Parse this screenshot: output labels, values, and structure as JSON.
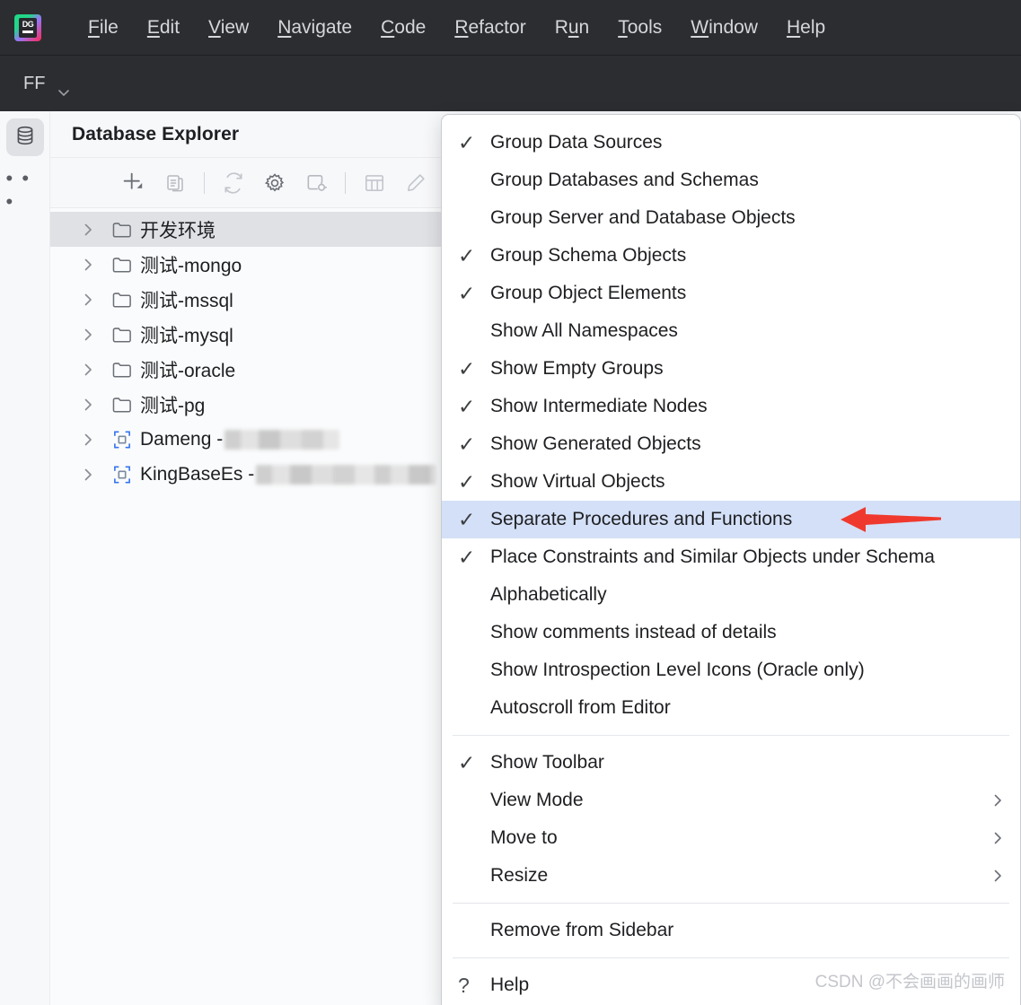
{
  "app": {
    "logo_text": "DG",
    "accent_red": "#f0392e",
    "highlight_blue": "#d4e0f7",
    "selection_gray": "#e0e1e5",
    "menubar_bg": "#2b2d30"
  },
  "menubar": {
    "items": [
      {
        "mnemonic": "F",
        "rest": "ile",
        "name": "file"
      },
      {
        "mnemonic": "E",
        "rest": "dit",
        "name": "edit"
      },
      {
        "mnemonic": "V",
        "rest": "iew",
        "name": "view"
      },
      {
        "mnemonic": "N",
        "rest": "avigate",
        "name": "navigate"
      },
      {
        "mnemonic": "C",
        "rest": "ode",
        "name": "code"
      },
      {
        "mnemonic": "R",
        "rest": "efactor",
        "name": "refactor"
      },
      {
        "mnemonic": "R",
        "rest": "un",
        "name": "run",
        "mn_index": 1,
        "pre": "R",
        "mid": "u",
        "post": "n"
      },
      {
        "mnemonic": "T",
        "rest": "ools",
        "name": "tools"
      },
      {
        "mnemonic": "W",
        "rest": "indow",
        "name": "window"
      },
      {
        "mnemonic": "H",
        "rest": "elp",
        "name": "help"
      }
    ]
  },
  "subbar": {
    "project_name": "FF",
    "chevron_icon": "chevron-down-icon"
  },
  "rail": {
    "active_tool": "database-explorer",
    "database_icon": "database-icon",
    "more_label": "• • •"
  },
  "tool_window": {
    "title": "Database Explorer",
    "header_actions": [
      {
        "name": "scroll-from-source-icon",
        "icon": "target-icon"
      },
      {
        "name": "expand-collapse-icon",
        "icon": "chevron-updown-icon"
      },
      {
        "name": "hide-icon",
        "icon": "collapse-x-icon"
      }
    ],
    "toolbar_buttons": [
      {
        "name": "add-new-button",
        "icon": "plus-dropdown-icon"
      },
      {
        "name": "duplicate-button",
        "icon": "copy-document-icon"
      },
      {
        "name": "refresh-button",
        "icon": "refresh-icon"
      },
      {
        "name": "data-source-properties-button",
        "icon": "gear-icon"
      },
      {
        "name": "disconnect-button",
        "icon": "database-plug-icon"
      },
      {
        "name": "open-table-button",
        "icon": "table-icon"
      },
      {
        "name": "modify-button",
        "icon": "pencil-icon"
      },
      {
        "name": "sync-button",
        "icon": "sync-arrows-icon"
      },
      {
        "name": "open-console-button",
        "icon": "console-icon"
      }
    ]
  },
  "tree": {
    "items": [
      {
        "label": "开发环境",
        "icon": "folder-icon",
        "selected": true,
        "blurred": false
      },
      {
        "label": "测试-mongo",
        "icon": "folder-icon",
        "selected": false,
        "blurred": false
      },
      {
        "label": "测试-mssql",
        "icon": "folder-icon",
        "selected": false,
        "blurred": false
      },
      {
        "label": "测试-mysql",
        "icon": "folder-icon",
        "selected": false,
        "blurred": false
      },
      {
        "label": "测试-oracle",
        "icon": "folder-icon",
        "selected": false,
        "blurred": false
      },
      {
        "label": "测试-pg",
        "icon": "folder-icon",
        "selected": false,
        "blurred": false
      },
      {
        "label": "Dameng -",
        "icon": "datasource-icon",
        "selected": false,
        "blurred": true,
        "blur_width": 128
      },
      {
        "label": "KingBaseEs -",
        "icon": "datasource-icon",
        "selected": false,
        "blurred": true,
        "blur_width": 200
      }
    ]
  },
  "context_menu": {
    "groups": [
      {
        "items": [
          {
            "label": "Group Data Sources",
            "checked": true,
            "submenu": false,
            "highlight": false
          },
          {
            "label": "Group Databases and Schemas",
            "checked": false,
            "submenu": false,
            "highlight": false
          },
          {
            "label": "Group Server and Database Objects",
            "checked": false,
            "submenu": false,
            "highlight": false
          },
          {
            "label": "Group Schema Objects",
            "checked": true,
            "submenu": false,
            "highlight": false
          },
          {
            "label": "Group Object Elements",
            "checked": true,
            "submenu": false,
            "highlight": false
          },
          {
            "label": "Show All Namespaces",
            "checked": false,
            "submenu": false,
            "highlight": false
          },
          {
            "label": "Show Empty Groups",
            "checked": true,
            "submenu": false,
            "highlight": false
          },
          {
            "label": "Show Intermediate Nodes",
            "checked": true,
            "submenu": false,
            "highlight": false
          },
          {
            "label": "Show Generated Objects",
            "checked": true,
            "submenu": false,
            "highlight": false
          },
          {
            "label": "Show Virtual Objects",
            "checked": true,
            "submenu": false,
            "highlight": false
          },
          {
            "label": "Separate Procedures and Functions",
            "checked": true,
            "submenu": false,
            "highlight": true
          },
          {
            "label": "Place Constraints and Similar Objects under Schema",
            "checked": true,
            "submenu": false,
            "highlight": false
          },
          {
            "label": "Alphabetically",
            "checked": false,
            "submenu": false,
            "highlight": false
          },
          {
            "label": "Show comments instead of details",
            "checked": false,
            "submenu": false,
            "highlight": false
          },
          {
            "label": "Show Introspection Level Icons (Oracle only)",
            "checked": false,
            "submenu": false,
            "highlight": false
          },
          {
            "label": "Autoscroll from Editor",
            "checked": false,
            "submenu": false,
            "highlight": false
          }
        ]
      },
      {
        "items": [
          {
            "label": "Show Toolbar",
            "checked": true,
            "submenu": false,
            "highlight": false
          },
          {
            "label": "View Mode",
            "checked": false,
            "submenu": true,
            "highlight": false
          },
          {
            "label": "Move to",
            "checked": false,
            "submenu": true,
            "highlight": false
          },
          {
            "label": "Resize",
            "checked": false,
            "submenu": true,
            "highlight": false
          }
        ]
      },
      {
        "items": [
          {
            "label": "Remove from Sidebar",
            "checked": false,
            "submenu": false,
            "highlight": false
          }
        ]
      },
      {
        "items": [
          {
            "label": "Help",
            "checked": false,
            "submenu": false,
            "highlight": false,
            "help_icon": "?"
          }
        ]
      }
    ],
    "check_glyph": "✓"
  },
  "annotation": {
    "arrow_color": "#f0392e",
    "arrow_direction": "left",
    "points_at": "Separate Procedures and Functions"
  },
  "watermark": {
    "text": "CSDN @不会画画的画师"
  }
}
